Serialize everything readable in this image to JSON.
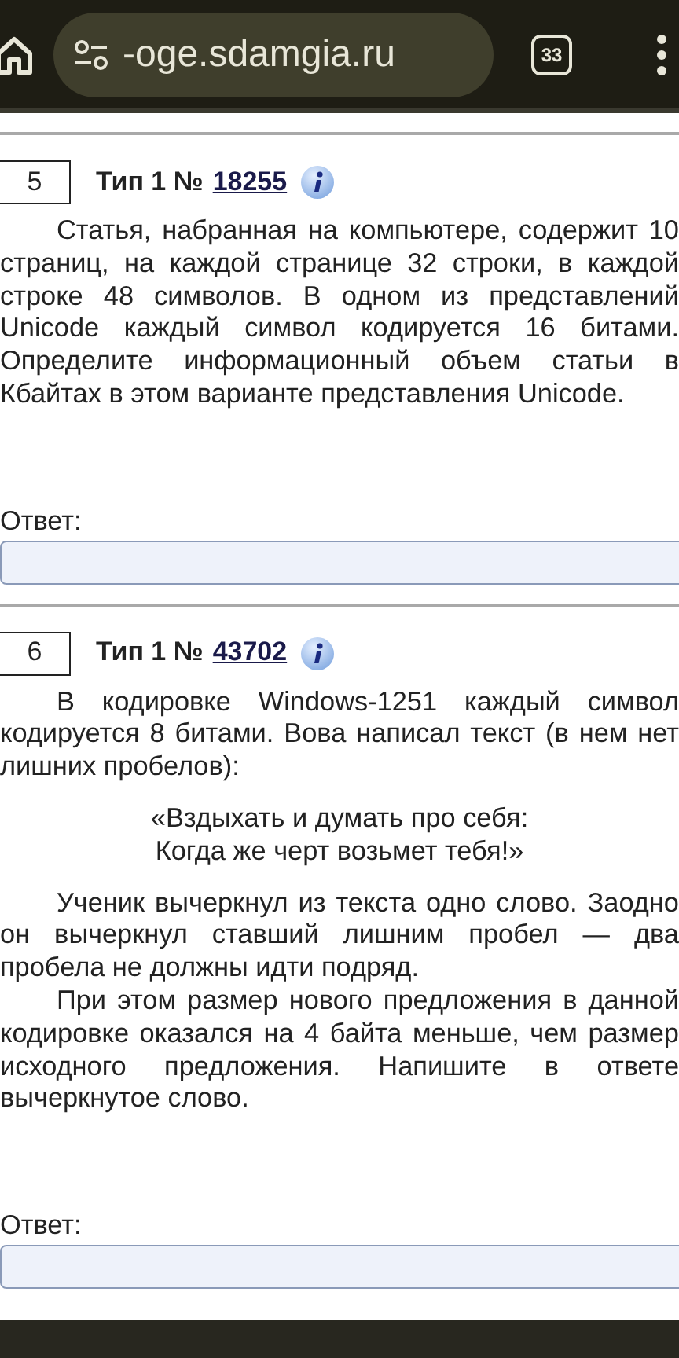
{
  "browser": {
    "url": "-oge.sdamgia.ru",
    "tab_count": "33"
  },
  "tasks": [
    {
      "number": "5",
      "type_label": "Тип 1 №",
      "id": "18255",
      "paragraphs": [
        {
          "kind": "indent",
          "text": "Статья, набранная на компьютере, содержит 10 страниц, на каждой странице 32 строки, в каждой строке 48 символов. В одном из представлений Unicode каждый символ кодируется 16 битами. Определите информационный объем статьи в Кбайтах в этом варианте представления Unicode."
        }
      ],
      "answer_label": "Ответ:"
    },
    {
      "number": "6",
      "type_label": "Тип 1 №",
      "id": "43702",
      "paragraphs": [
        {
          "kind": "indent",
          "text": "В кодировке Windows-1251 каждый символ кодируется 8 битами. Вова написал текст (в нем нет лишних пробелов):"
        },
        {
          "kind": "quote",
          "lines": [
            "«Вздыхать и думать про себя:",
            "Когда же черт возьмет тебя!»"
          ]
        },
        {
          "kind": "indent",
          "text": "Ученик вычеркнул из текста одно слово. Заодно он вычеркнул ставший лишним пробел — два пробела не должны идти подряд."
        },
        {
          "kind": "indent",
          "text": "При этом размер нового предложения в данной кодировке оказался на 4 байта меньше, чем размер исходного предложения. Напишите в ответе вычеркнутое слово."
        }
      ],
      "answer_label": "Ответ:"
    }
  ]
}
